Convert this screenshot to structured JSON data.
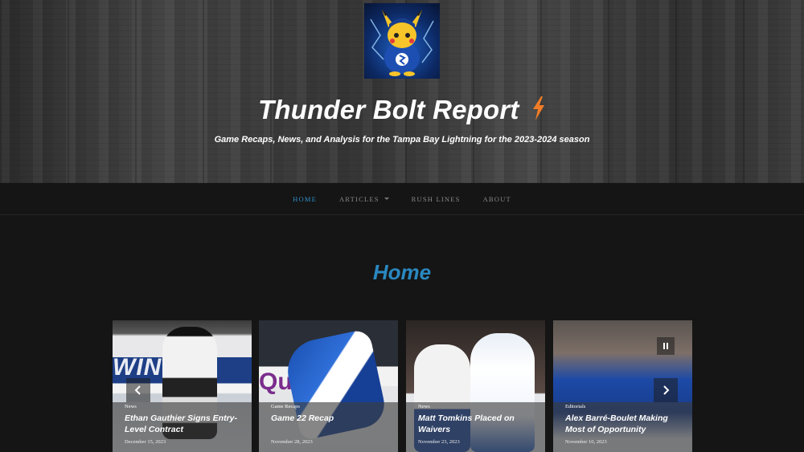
{
  "site": {
    "title": "Thunder Bolt Report",
    "tagline": "Game Recaps, News, and Analysis for the Tampa Bay Lightning for the 2023-2024 season",
    "bolt_color": "#f07c27"
  },
  "nav": {
    "items": [
      {
        "label": "Home",
        "active": true
      },
      {
        "label": "Articles",
        "has_dropdown": true
      },
      {
        "label": "Rush Lines"
      },
      {
        "label": "About"
      }
    ]
  },
  "page": {
    "heading": "Home"
  },
  "slider": {
    "cards": [
      {
        "category": "News",
        "title": "Ethan Gauthier Signs Entry-Level Contract",
        "date": "December 15, 2023",
        "wordmark": "WINNER"
      },
      {
        "category": "Game Recaps",
        "title": "Game 22 Recap",
        "date": "November 28, 2023",
        "wordmark": "Que"
      },
      {
        "category": "News",
        "title": "Matt Tomkins Placed on Waivers",
        "date": "November 23, 2023"
      },
      {
        "category": "Editorials",
        "title": "Alex Barré-Boulet Making Most of Opportunity",
        "date": "November 10, 2023"
      }
    ],
    "prev_icon": "chevron-left-icon",
    "next_icon": "chevron-right-icon",
    "pause_icon": "pause-icon"
  },
  "colors": {
    "accent": "#2e90c8",
    "heading": "#2a88c0"
  }
}
